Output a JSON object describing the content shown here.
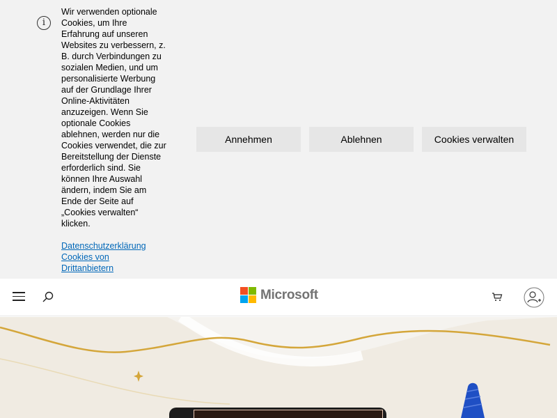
{
  "cookie_banner": {
    "info_icon": "info-icon",
    "text": "Wir verwenden optionale Cookies, um Ihre Erfahrung auf unseren Websites zu verbessern, z. B. durch Verbindungen zu sozialen Medien, und um personalisierte Werbung auf der Grundlage Ihrer Online-Aktivitäten anzuzeigen. Wenn Sie optionale Cookies ablehnen, werden nur die Cookies verwendet, die zur Bereitstellung der Dienste erforderlich sind. Sie können Ihre Auswahl ändern, indem Sie am Ende der Seite auf „Cookies verwalten“ klicken.",
    "links": {
      "privacy": "Datenschutzerklärung",
      "third_party": "Cookies von Drittanbietern"
    },
    "buttons": {
      "accept": "Annehmen",
      "reject": "Ablehnen",
      "manage": "Cookies verwalten"
    }
  },
  "header": {
    "logo_text": "Microsoft",
    "icons": [
      "hamburger-menu-icon",
      "search-icon",
      "cart-icon",
      "account-icon"
    ]
  },
  "colors": {
    "banner_bg": "#f2f2f2",
    "link": "#0067b8",
    "button_bg": "#e6e6e6",
    "ms_red": "#f25022",
    "ms_green": "#7fba00",
    "ms_blue": "#00a4ef",
    "ms_yellow": "#ffb900",
    "hero_gold": "#d4a63a",
    "hero_blue": "#1f4fc4"
  }
}
